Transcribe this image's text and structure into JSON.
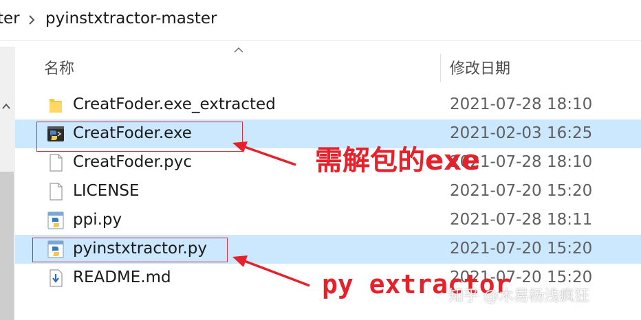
{
  "breadcrumb": {
    "previous": "ter",
    "current": "pyinstxtractor-master"
  },
  "columns": {
    "name": "名称",
    "date": "修改日期"
  },
  "files": [
    {
      "name": "CreatFoder.exe_extracted",
      "date": "2021-07-28 18:10",
      "icon": "folder-icon",
      "selected": false
    },
    {
      "name": "CreatFoder.exe",
      "date": "2021-02-03 16:25",
      "icon": "python-exe-icon",
      "selected": true
    },
    {
      "name": "CreatFoder.pyc",
      "date": "2021-07-28 18:10",
      "icon": "file-icon",
      "selected": false
    },
    {
      "name": "LICENSE",
      "date": "2021-07-20 15:20",
      "icon": "file-icon",
      "selected": false
    },
    {
      "name": "ppi.py",
      "date": "2021-07-28 18:11",
      "icon": "python-file-icon",
      "selected": false
    },
    {
      "name": "pyinstxtractor.py",
      "date": "2021-07-20 15:20",
      "icon": "python-file-icon",
      "selected": true
    },
    {
      "name": "README.md",
      "date": "2021-07-20 15:20",
      "icon": "markdown-file-icon",
      "selected": false
    }
  ],
  "annotations": {
    "exe_label": "需解包的exe",
    "extractor_label": "py extractor",
    "color": "#e8202a"
  },
  "watermark": "知乎 @木易杨浅疯狂"
}
